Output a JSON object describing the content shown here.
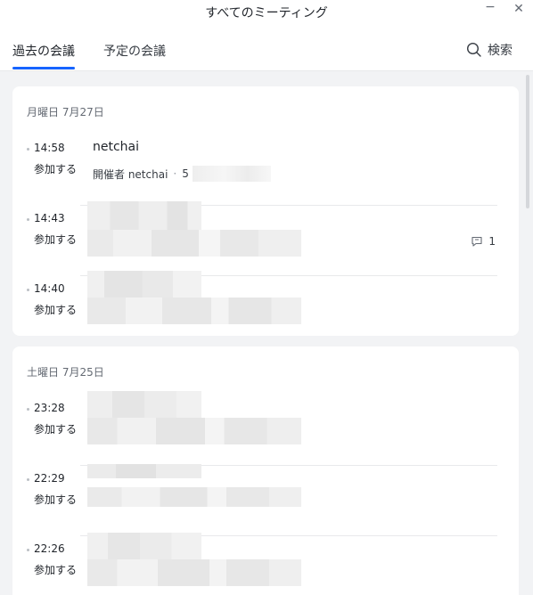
{
  "window": {
    "title": "すべてのミーティング",
    "minimize_glyph": "−",
    "close_glyph": "✕"
  },
  "tabs": {
    "past": "過去の会議",
    "upcoming": "予定の会議"
  },
  "search": {
    "label": "検索",
    "icon": "search-icon"
  },
  "groups": [
    {
      "date": "月曜日 7月27日",
      "meetings": [
        {
          "time": "14:58",
          "join": "参加する",
          "title": "netchai",
          "organizer": "開催者 netchai",
          "dot_sep": "·",
          "extra": "5"
        },
        {
          "time": "14:43",
          "join": "参加する",
          "comments": "1"
        },
        {
          "time": "14:40",
          "join": "参加する"
        }
      ]
    },
    {
      "date": "土曜日 7月25日",
      "meetings": [
        {
          "time": "23:28",
          "join": "参加する"
        },
        {
          "time": "22:29",
          "join": "参加する"
        },
        {
          "time": "22:26",
          "join": "参加する"
        }
      ]
    }
  ],
  "colors": {
    "accent": "#1664ff",
    "background": "#f2f3f5"
  }
}
